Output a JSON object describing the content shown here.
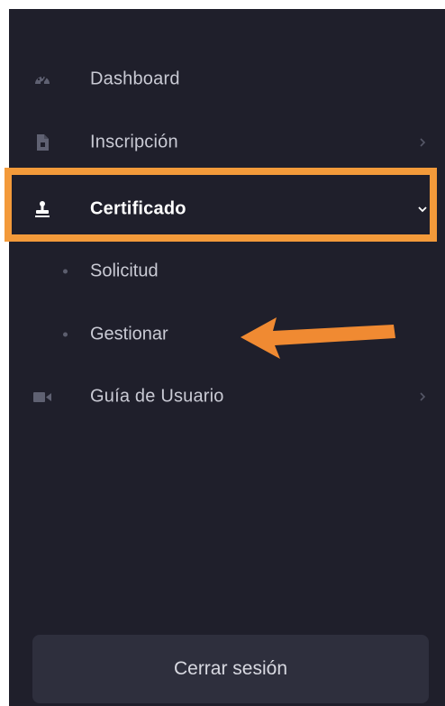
{
  "sidebar": {
    "items": [
      {
        "label": "Dashboard",
        "icon": "speedometer-icon",
        "has_chevron": false
      },
      {
        "label": "Inscripción",
        "icon": "document-icon",
        "has_chevron": true
      },
      {
        "label": "Certificado",
        "icon": "stamp-icon",
        "has_chevron": true,
        "expanded": true
      },
      {
        "label": "Guía de Usuario",
        "icon": "video-camera-icon",
        "has_chevron": true
      }
    ],
    "subitems": [
      {
        "label": "Solicitud"
      },
      {
        "label": "Gestionar"
      }
    ],
    "logout_label": "Cerrar sesión"
  },
  "colors": {
    "sidebar_bg": "#1f1f2b",
    "highlight": "#f39a3a",
    "arrow": "#f08a32",
    "logout_bg": "#2e2f3d",
    "text": "#c9cad4",
    "active_text": "#ffffff"
  }
}
